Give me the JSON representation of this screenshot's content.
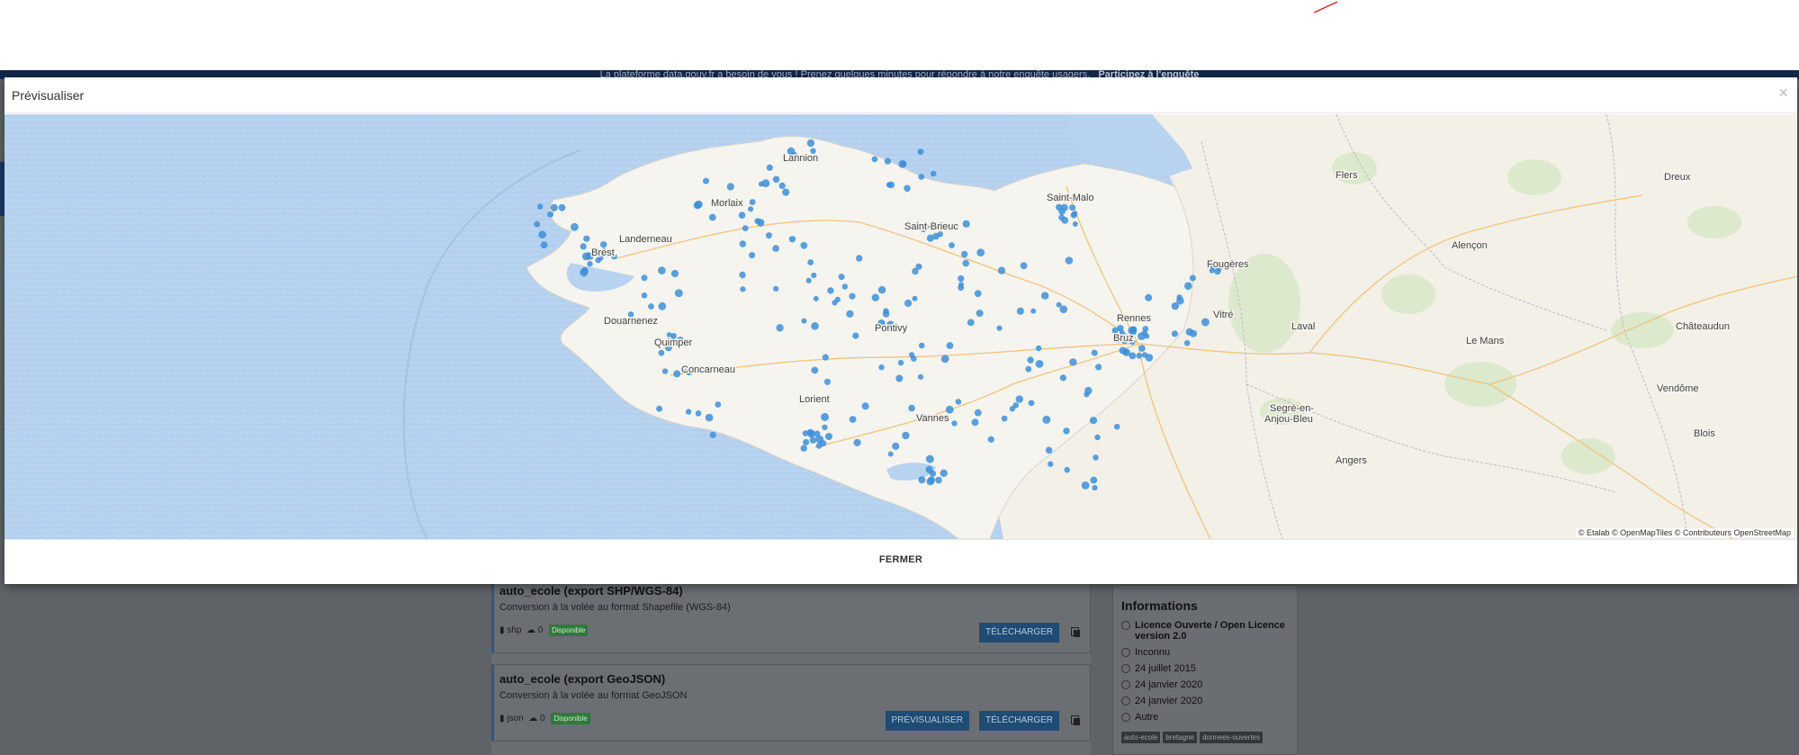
{
  "banner": {
    "text": "La plateforme data.gouv.fr a besoin de vous ! Prenez quelques minutes pour répondre à notre enquête usagers.",
    "link": "Participez à l'enquête"
  },
  "modal": {
    "title": "Prévisualiser",
    "close_symbol": "×",
    "footer_button": "FERMER",
    "attribution": "© Etalab © OpenMapTiles © Contributeurs OpenStreetMap",
    "marker_color": "#3d8fd8",
    "sea_color": "#b7d3f0",
    "land_color": "#f6f4ef"
  },
  "map_labels": {
    "lannion": "Lannion",
    "morlaix": "Morlaix",
    "landerneau": "Landerneau",
    "brest": "Brest",
    "douarnenez": "Douarnenez",
    "quimper": "Quimper",
    "concarneau": "Concarneau",
    "lorient": "Lorient",
    "pontivy": "Pontivy",
    "vannes": "Vannes",
    "saint_brieuc": "Saint-Brieuc",
    "saint_malo": "Saint-Malo",
    "rennes": "Rennes",
    "bruz": "Bruz",
    "fougeres": "Fougères",
    "vitre": "Vitré",
    "laval": "Laval",
    "flers": "Flers",
    "alencon": "Alençon",
    "le_mans": "Le Mans",
    "dreux": "Dreux",
    "chateaudun": "Châteaudun",
    "vendome": "Vendôme",
    "blois": "Blois",
    "segre_1": "Segré-en-",
    "segre_2": "Anjou-Bleu",
    "angers": "Angers"
  },
  "resources": [
    {
      "name": "auto_ecole (export SHP/WGS-84)",
      "description": "Conversion à la volée au format Shapefile (WGS-84)",
      "format": "shp",
      "downloads": "0",
      "status": "Disponible",
      "download_label": "TÉLÉCHARGER"
    },
    {
      "name": "auto_ecole (export GeoJSON)",
      "description": "Conversion à la volée au format GeoJSON",
      "format": "json",
      "downloads": "0",
      "status": "Disponible",
      "preview_label": "PRÉVISUALISER",
      "download_label": "TÉLÉCHARGER"
    }
  ],
  "info": {
    "heading": "Informations",
    "license": "Licence Ouverte / Open Licence version 2.0",
    "frequency": "Inconnu",
    "created": "24 juillet 2015",
    "updated": "24 janvier 2020",
    "downloaded": "24 janvier 2020",
    "other": "Autre",
    "tags": [
      "auto-ecole",
      "bretagne",
      "donnees-ouvertes"
    ]
  }
}
